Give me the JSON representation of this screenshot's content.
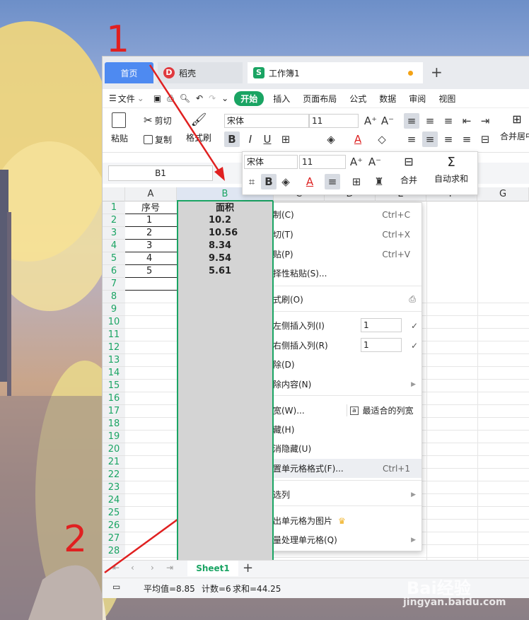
{
  "annotations": {
    "step1": "1",
    "step2": "2"
  },
  "tabs": {
    "home": "首页",
    "doc": "稻壳",
    "book": "工作簿1"
  },
  "menu": [
    "文件",
    "开始",
    "插入",
    "页面布局",
    "公式",
    "数据",
    "审阅",
    "视图"
  ],
  "ribbon": {
    "paste": "粘贴",
    "cut": "剪切",
    "copy": "复制",
    "painter": "格式刷",
    "font": "宋体",
    "size": "11",
    "merge": "合并居中"
  },
  "minitoolbar": {
    "font": "宋体",
    "size": "11",
    "merge": "合并",
    "autosum": "自动求和"
  },
  "namebox": "B1",
  "columns": [
    "A",
    "B",
    "C",
    "D",
    "E",
    "F",
    "G"
  ],
  "rows": [
    "1",
    "2",
    "3",
    "4",
    "5",
    "6",
    "7",
    "8",
    "9",
    "10",
    "11",
    "12",
    "13",
    "14",
    "15",
    "16",
    "17",
    "18",
    "19",
    "20",
    "21",
    "22",
    "23",
    "24",
    "25",
    "26",
    "27",
    "28"
  ],
  "table": {
    "headers": [
      "序号",
      "面积"
    ],
    "rows": [
      [
        "1",
        "10.2"
      ],
      [
        "2",
        "10.56"
      ],
      [
        "3",
        "8.34"
      ],
      [
        "4",
        "9.54"
      ],
      [
        "5",
        "5.61"
      ]
    ]
  },
  "context_menu": {
    "copy": "复制(C)",
    "copy_sc": "Ctrl+C",
    "cut": "剪切(T)",
    "cut_sc": "Ctrl+X",
    "paste": "粘贴(P)",
    "paste_sc": "Ctrl+V",
    "paste_special": "选择性粘贴(S)...",
    "format_painter": "格式刷(O)",
    "insert_left": "在左侧插入列(I)",
    "insert_left_n": "1",
    "insert_right": "在右侧插入列(R)",
    "insert_right_n": "1",
    "delete": "删除(D)",
    "clear": "清除内容(N)",
    "col_width": "列宽(W)...",
    "best_fit": "最适合的列宽",
    "hide": "隐藏(H)",
    "unhide": "取消隐藏(U)",
    "format_cells": "设置单元格格式(F)...",
    "format_cells_sc": "Ctrl+1",
    "filter": "筛选列",
    "export_image": "输出单元格为图片",
    "batch": "批量处理单元格(Q)"
  },
  "sheet": "Sheet1",
  "status": {
    "avg": "平均值=8.85",
    "count": "计数=6",
    "sum": "求和=44.25"
  },
  "watermark": {
    "brand": "Bai经验",
    "url": "jingyan.baidu.com"
  },
  "colors": {
    "accent_green": "#1aa463",
    "tab_blue": "#4e8af1",
    "arrow_red": "#e02020"
  }
}
